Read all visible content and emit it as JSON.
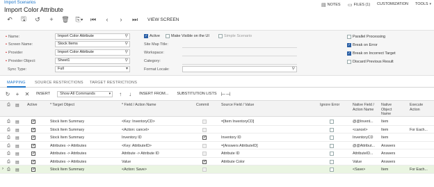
{
  "breadcrumb": "Import Scenarios",
  "title": "Import Color Attribute",
  "topmenu": {
    "notes": "NOTES",
    "files": "FILES (1)",
    "customization": "CUSTOMIZATION",
    "tools": "TOOLS"
  },
  "toolbar": {
    "view_screen": "VIEW SCREEN"
  },
  "form": {
    "name_label": "Name:",
    "name_value": "Import Color Attribute",
    "screen_label": "Screen Name:",
    "screen_value": "Stock Items",
    "provider_label": "Provider",
    "provider_value": "Import Color Attribute",
    "provider_obj_label": "Provider Object:",
    "provider_obj_value": "Sheet1",
    "sync_label": "Sync Type:",
    "sync_value": "Full",
    "active_label": "Active",
    "make_visible_label": "Make Visible on the UI",
    "simple_label": "Simple Scenario",
    "sitemap_label": "Site Map Title:",
    "workspace_label": "Workspace:",
    "category_label": "Category:",
    "format_locale_label": "Format Locale:",
    "parallel_label": "Parallel Processing",
    "break_error_label": "Break on Error",
    "break_target_label": "Break on Incorrect Target",
    "discard_label": "Discard Previous Result"
  },
  "tabs": [
    "MAPPING",
    "SOURCE RESTRICTIONS",
    "TARGET RESTRICTIONS"
  ],
  "gridbar": {
    "insert": "INSERT",
    "commands": "Show All Commands",
    "insert_from": "INSERT FROM...",
    "substitution": "SUBSTITUTION LISTS"
  },
  "grid": {
    "headers": {
      "active": "Active",
      "target": "* Target Object",
      "field": "* Field / Action Name",
      "commit": "Commit",
      "source": "Source Field / Value",
      "ignore": "Ignore Error",
      "native_field": "Native Field / Action Name",
      "native_obj": "Native Object Name",
      "exec": "Execute Action"
    },
    "rows": [
      {
        "target": "Stock Item Summary",
        "field": "<Key: InventoryCD>",
        "commit": "dis",
        "source": "=[Item InventoryCD]",
        "native_field": "@@Invent...",
        "native_obj": "Item",
        "exec": ""
      },
      {
        "target": "Stock Item Summary",
        "field": "<Action: cancel>",
        "commit": "dis",
        "source": "",
        "native_field": "<cancel>",
        "native_obj": "Item",
        "exec": "For Each..."
      },
      {
        "target": "Stock Item Summary",
        "field": "Inventory ID",
        "commit": "on",
        "source": "Inventory ID",
        "native_field": "InventoryCD",
        "native_obj": "Item",
        "exec": ""
      },
      {
        "target": "Attributes -> Attributes",
        "field": "<Key: AttributeID>",
        "commit": "dis",
        "source": "=[Answers AttributeID]",
        "native_field": "@@Attribut...",
        "native_obj": "Answers",
        "exec": ""
      },
      {
        "target": "Attributes -> Attributes",
        "field": "Attribute -> Attribute ID",
        "commit": "dis",
        "source": "Attribute ID",
        "native_field": "AttributeID...",
        "native_obj": "Answers",
        "exec": ""
      },
      {
        "target": "Attributes -> Attributes",
        "field": "Value",
        "commit": "on",
        "source": "Attribute Color",
        "native_field": "Value",
        "native_obj": "Answers",
        "exec": ""
      },
      {
        "target": "Stock Item Summary",
        "field": "<Action: Save>",
        "commit": "dis",
        "source": "",
        "native_field": "<Save>",
        "native_obj": "Item",
        "exec": "For Each..."
      }
    ]
  }
}
